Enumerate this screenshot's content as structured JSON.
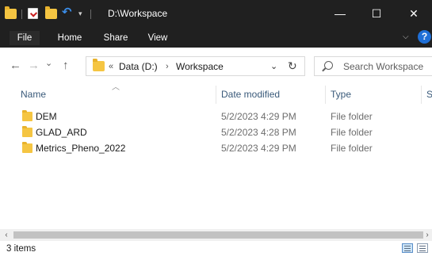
{
  "window": {
    "title": "D:\\Workspace",
    "minimize_glyph": "—",
    "maximize_glyph": "☐",
    "close_glyph": "✕"
  },
  "ribbon": {
    "tabs": [
      "File",
      "Home",
      "Share",
      "View"
    ],
    "help_glyph": "?"
  },
  "nav": {
    "back_glyph": "←",
    "forward_glyph": "→",
    "recent_glyph": "⌄",
    "up_glyph": "↑",
    "breadcrumb": {
      "overflow": "«",
      "items": [
        "Data (D:)",
        "Workspace"
      ],
      "separator": "›"
    },
    "dropdown_glyph": "⌄",
    "refresh_glyph": "↻"
  },
  "search": {
    "placeholder": "Search Workspace"
  },
  "columns": {
    "name": "Name",
    "date_modified": "Date modified",
    "type": "Type",
    "size": "Si"
  },
  "files": [
    {
      "name": "DEM",
      "date": "5/2/2023 4:29 PM",
      "type": "File folder"
    },
    {
      "name": "GLAD_ARD",
      "date": "5/2/2023 4:28 PM",
      "type": "File folder"
    },
    {
      "name": "Metrics_Pheno_2022",
      "date": "5/2/2023 4:29 PM",
      "type": "File folder"
    }
  ],
  "status": {
    "item_count": "3 items"
  },
  "colors": {
    "titlebar_bg": "#202020",
    "folder": "#f5c542",
    "header_text": "#3a5a7a",
    "accent": "#1f6fd6"
  }
}
